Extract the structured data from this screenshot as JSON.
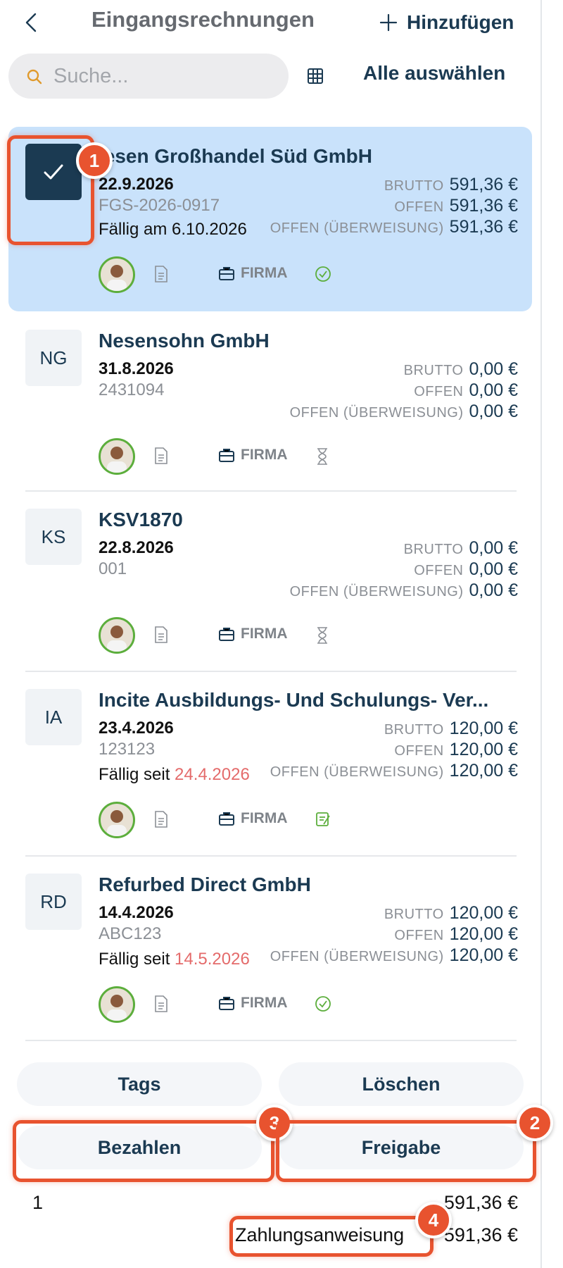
{
  "header": {
    "title": "Eingangsrechnungen",
    "add_label": "Hinzufügen"
  },
  "search": {
    "placeholder": "Suche..."
  },
  "toolbar": {
    "select_all_label": "Alle auswählen"
  },
  "labels": {
    "brutto": "BRUTTO",
    "offen": "OFFEN",
    "offen_ueberweisung": "OFFEN (ÜBERWEISUNG)",
    "firma": "FIRMA"
  },
  "invoices": [
    {
      "initials": "",
      "vendor": "iesen Großhandel Süd GmbH",
      "date": "22.9.2026",
      "ref": "FGS-2026-0917",
      "due_prefix": "Fällig am ",
      "due_date": "6.10.2026",
      "brutto": "591,36 €",
      "offen": "591,36 €",
      "offen_ueberweisung": "591,36 €",
      "status": "check-circle-icon",
      "selected": true
    },
    {
      "initials": "NG",
      "vendor": "Nesensohn GmbH",
      "date": "31.8.2026",
      "ref": "2431094",
      "due_prefix": "",
      "due_date": "",
      "brutto": "0,00 €",
      "offen": "0,00 €",
      "offen_ueberweisung": "0,00 €",
      "status": "hourglass-icon",
      "selected": false
    },
    {
      "initials": "KS",
      "vendor": "KSV1870",
      "date": "22.8.2026",
      "ref": "001",
      "due_prefix": "",
      "due_date": "",
      "brutto": "0,00 €",
      "offen": "0,00 €",
      "offen_ueberweisung": "0,00 €",
      "status": "hourglass-icon",
      "selected": false
    },
    {
      "initials": "IA",
      "vendor": "Incite Ausbildungs- Und Schulungs- Ver...",
      "date": "23.4.2026",
      "ref": "123123",
      "due_prefix": "Fällig seit ",
      "due_date": "24.4.2026",
      "brutto": "120,00 €",
      "offen": "120,00 €",
      "offen_ueberweisung": "120,00 €",
      "status": "approval-note-icon",
      "selected": false
    },
    {
      "initials": "RD",
      "vendor": "Refurbed Direct GmbH",
      "date": "14.4.2026",
      "ref": "ABC123",
      "due_prefix": "Fällig seit ",
      "due_date": "14.5.2026",
      "brutto": "120,00 €",
      "offen": "120,00 €",
      "offen_ueberweisung": "120,00 €",
      "status": "check-circle-icon",
      "selected": false
    }
  ],
  "actions": {
    "tags": "Tags",
    "delete": "Löschen",
    "pay": "Bezahlen",
    "approve": "Freigabe"
  },
  "footer": {
    "count": "1",
    "total": "591,36 €",
    "payment_label": "Zahlungsanweisung",
    "payment_total": "591,36 €"
  },
  "annotations": [
    "1",
    "2",
    "3",
    "4"
  ],
  "colors": {
    "accent": "#1b3a52",
    "selected_bg": "#c9e2fb",
    "highlight": "#e8532f",
    "overdue": "#e46b6b",
    "approved": "#5cae3c"
  }
}
